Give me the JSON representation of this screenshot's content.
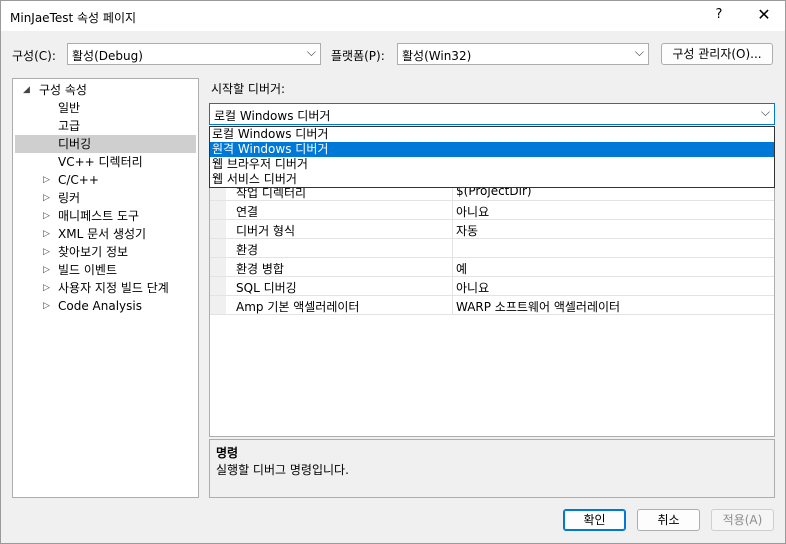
{
  "window": {
    "title": "MinJaeTest 속성 페이지",
    "help": "?",
    "close": "✕"
  },
  "config": {
    "config_label": "구성(C):",
    "config_value": "활성(Debug)",
    "platform_label": "플랫폼(P):",
    "platform_value": "활성(Win32)",
    "manager_button": "구성 관리자(O)..."
  },
  "tree": [
    {
      "label": "구성 속성",
      "expander": "◢",
      "indent": 0
    },
    {
      "label": "일반",
      "expander": "",
      "indent": 1
    },
    {
      "label": "고급",
      "expander": "",
      "indent": 1
    },
    {
      "label": "디버깅",
      "expander": "",
      "indent": 1,
      "selected": true
    },
    {
      "label": "VC++ 디렉터리",
      "expander": "",
      "indent": 1
    },
    {
      "label": "C/C++",
      "expander": "▷",
      "indent": 1
    },
    {
      "label": "링커",
      "expander": "▷",
      "indent": 1
    },
    {
      "label": "매니페스트 도구",
      "expander": "▷",
      "indent": 1
    },
    {
      "label": "XML 문서 생성기",
      "expander": "▷",
      "indent": 1
    },
    {
      "label": "찾아보기 정보",
      "expander": "▷",
      "indent": 1
    },
    {
      "label": "빌드 이벤트",
      "expander": "▷",
      "indent": 1
    },
    {
      "label": "사용자 지정 빌드 단계",
      "expander": "▷",
      "indent": 1
    },
    {
      "label": "Code Analysis",
      "expander": "▷",
      "indent": 1
    }
  ],
  "debugger": {
    "label": "시작할 디버거:",
    "value": "로컬 Windows 디버거",
    "options": [
      "로컬 Windows 디버거",
      "원격 Windows 디버거",
      "웹 브라우저 디버거",
      "웹 서비스 디버거"
    ],
    "highlighted_index": 1
  },
  "properties": [
    {
      "name": "작업 디렉터리",
      "value": "$(ProjectDir)"
    },
    {
      "name": "연결",
      "value": "아니요"
    },
    {
      "name": "디버거 형식",
      "value": "자동"
    },
    {
      "name": "환경",
      "value": ""
    },
    {
      "name": "환경 병합",
      "value": "예"
    },
    {
      "name": "SQL 디버깅",
      "value": "아니요"
    },
    {
      "name": "Amp 기본 액셀러레이터",
      "value": "WARP 소프트웨어 액셀러레이터"
    }
  ],
  "description": {
    "title": "명령",
    "text": "실행할 디버그 명령입니다."
  },
  "buttons": {
    "ok": "확인",
    "cancel": "취소",
    "apply": "적용(A)"
  },
  "colors": {
    "selection": "#0078d7",
    "tree_selected": "#cfcfcf"
  }
}
